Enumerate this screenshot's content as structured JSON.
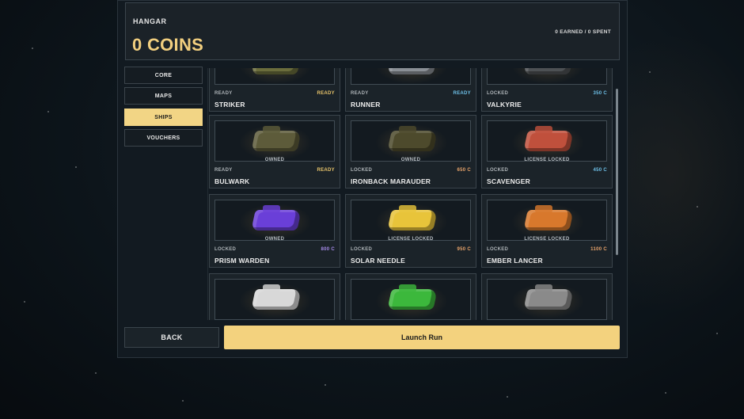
{
  "header": {
    "section_label": "HANGAR",
    "coins_label": "0 COINS",
    "earned_spent": "0 EARNED / 0 SPENT"
  },
  "tabs": [
    {
      "label": "CORE",
      "active": false
    },
    {
      "label": "MAPS",
      "active": false
    },
    {
      "label": "SHIPS",
      "active": true
    },
    {
      "label": "VOUCHERS",
      "active": false
    }
  ],
  "ships": [
    {
      "name": "STRIKER",
      "status": "READY",
      "price": "READY",
      "price_color": "#e8c46a",
      "overlay": "",
      "icon": "striker-ship-icon",
      "color": "#6b6d3c"
    },
    {
      "name": "RUNNER",
      "status": "READY",
      "price": "READY",
      "price_color": "#6ec0e8",
      "overlay": "",
      "icon": "runner-ship-icon",
      "color": "#8a8f95"
    },
    {
      "name": "VALKYRIE",
      "status": "LOCKED",
      "price": "350 C",
      "price_color": "#6ec0e8",
      "overlay": "",
      "icon": "valkyrie-ship-icon",
      "color": "#4d5154"
    },
    {
      "name": "BULWARK",
      "status": "READY",
      "price": "READY",
      "price_color": "#e8c46a",
      "overlay": "OWNED",
      "icon": "bulwark-ship-icon",
      "color": "#5d5b3a"
    },
    {
      "name": "IRONBACK MARAUDER",
      "status": "LOCKED",
      "price": "650 C",
      "price_color": "#e8a36a",
      "overlay": "OWNED",
      "icon": "ironback-marauder-ship-icon",
      "color": "#4d4a2c"
    },
    {
      "name": "SCAVENGER",
      "status": "LOCKED",
      "price": "450 C",
      "price_color": "#6ec0e8",
      "overlay": "LICENSE LOCKED",
      "icon": "scavenger-ship-icon",
      "color": "#c0503c"
    },
    {
      "name": "PRISM WARDEN",
      "status": "LOCKED",
      "price": "800 C",
      "price_color": "#a58ae8",
      "overlay": "OWNED",
      "icon": "prism-warden-ship-icon",
      "color": "#6a3fd8"
    },
    {
      "name": "SOLAR NEEDLE",
      "status": "LOCKED",
      "price": "950 C",
      "price_color": "#e8a36a",
      "overlay": "LICENSE LOCKED",
      "icon": "solar-needle-ship-icon",
      "color": "#e8c43a"
    },
    {
      "name": "EMBER LANCER",
      "status": "LOCKED",
      "price": "1100 C",
      "price_color": "#e8a36a",
      "overlay": "LICENSE LOCKED",
      "icon": "ember-lancer-ship-icon",
      "color": "#d8782c"
    },
    {
      "name": "",
      "status": "",
      "price": "",
      "price_color": "#e8c46a",
      "overlay": "",
      "icon": "white-interceptor-ship-icon",
      "color": "#d8d8d8"
    },
    {
      "name": "",
      "status": "",
      "price": "",
      "price_color": "#e8c46a",
      "overlay": "",
      "icon": "green-hull-ship-icon",
      "color": "#3cb83c"
    },
    {
      "name": "",
      "status": "",
      "price": "",
      "price_color": "#e8c46a",
      "overlay": "",
      "icon": "grey-walker-ship-icon",
      "color": "#8a8a8a"
    }
  ],
  "footer": {
    "back_label": "BACK",
    "launch_label": "Launch Run"
  }
}
